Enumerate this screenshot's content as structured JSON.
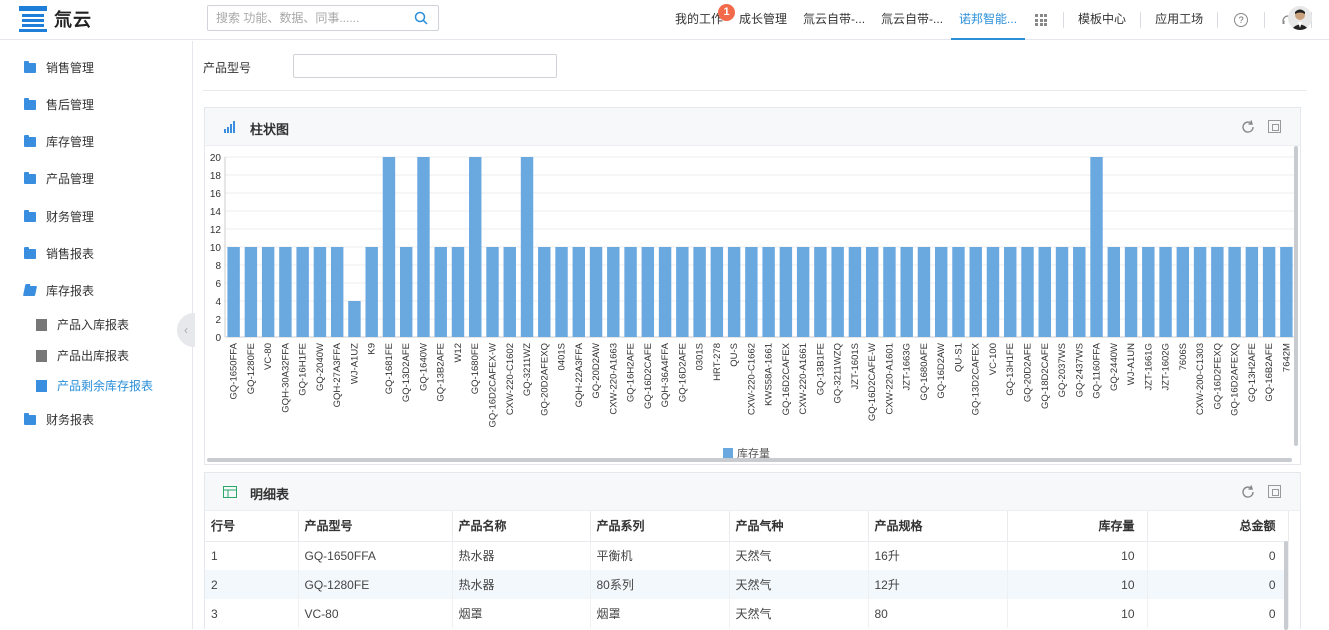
{
  "app": {
    "logo_text": "氚云",
    "search_placeholder": "搜索 功能、数据、同事......",
    "nav": [
      {
        "label": "我的工作",
        "badge": "1"
      },
      {
        "label": "成长管理"
      },
      {
        "label": "氚云自带-..."
      },
      {
        "label": "氚云自带-..."
      },
      {
        "label": "诺邦智能...",
        "active": true
      }
    ],
    "nav_right": [
      "模板中心",
      "应用工场"
    ],
    "accent": "#2a8fd8"
  },
  "sidebar": {
    "items": [
      {
        "label": "销售管理"
      },
      {
        "label": "售后管理"
      },
      {
        "label": "库存管理"
      },
      {
        "label": "产品管理"
      },
      {
        "label": "财务管理"
      },
      {
        "label": "销售报表"
      },
      {
        "label": "库存报表"
      },
      {
        "label": "财务报表"
      }
    ],
    "sub_items": [
      {
        "label": "产品入库报表"
      },
      {
        "label": "产品出库报表"
      },
      {
        "label": "产品剩余库存报表",
        "active": true
      }
    ]
  },
  "filter": {
    "label": "产品型号",
    "value": ""
  },
  "chart_panel": {
    "title": "柱状图"
  },
  "chart_data": {
    "type": "bar",
    "categories": [
      "GQ-1650FFA",
      "GQ-1280FE",
      "VC-80",
      "GQH-30A32FFA",
      "GQ-16H1FE",
      "GQ-2040W",
      "GQH-27A3FFA",
      "WJ-A1UZ",
      "K9",
      "GQ-1681FE",
      "GQ-13D2AFE",
      "GQ-1640W",
      "GQ-13B2AFE",
      "W12",
      "GQ-1680FE",
      "GQ-16D2CAFEX-W",
      "CXW-220-C1602",
      "GQ-3211WZ",
      "GQ-20D2AFEXQ",
      "0401S",
      "GQH-22A3FFA",
      "GQ-20D2AW",
      "CXW-220-A1663",
      "GQ-16H2AFE",
      "GQ-16D2CAFE",
      "GQH-36A4FFA",
      "GQ-16D2AFE",
      "0301S",
      "HRT-278",
      "QU-S",
      "CXW-220-C1662",
      "KWS58A-1661",
      "GQ-16D2CAFEX",
      "CXW-220-A1661",
      "GQ-13B1FE",
      "GQ-3211WZQ",
      "JZT-1601S",
      "GQ-16D2CAFE-W",
      "CXW-220-A1601",
      "JZT-1663G",
      "GQ-1680AFE",
      "GQ-16D2AW",
      "QU-S1",
      "GQ-13D2CAFEX",
      "VC-100",
      "GQ-13H1FE",
      "GQ-20D2AFE",
      "GQ-18D2CAFE",
      "GQ-2037WS",
      "GQ-2437WS",
      "GQ-1160FFA",
      "GQ-2440W",
      "WJ-A1UN",
      "JZT-1661G",
      "JZT-1602G",
      "7606S",
      "CXW-200-C1303",
      "GQ-16D2FEXQ",
      "GQ-16D2AFEXQ",
      "GQ-13H2AFE",
      "GQ-16B2AFE",
      "7642M"
    ],
    "series": [
      {
        "name": "库存量",
        "values": [
          10,
          10,
          10,
          10,
          10,
          10,
          10,
          4,
          10,
          20,
          10,
          20,
          10,
          10,
          20,
          10,
          10,
          20,
          10,
          10,
          10,
          10,
          10,
          10,
          10,
          10,
          10,
          10,
          10,
          10,
          10,
          10,
          10,
          10,
          10,
          10,
          10,
          10,
          10,
          10,
          10,
          10,
          10,
          10,
          10,
          10,
          10,
          10,
          10,
          10,
          20,
          10,
          10,
          10,
          10,
          10,
          10,
          10,
          10,
          10,
          10,
          10
        ]
      }
    ],
    "yticks": [
      0,
      2,
      4,
      6,
      8,
      10,
      12,
      14,
      16,
      18,
      20
    ],
    "ylim": [
      0,
      20
    ],
    "bar_color": "#6aa8e0",
    "grid": true,
    "legend_position": "bottom-center"
  },
  "table_panel": {
    "title": "明细表",
    "columns": [
      "行号",
      "产品型号",
      "产品名称",
      "产品系列",
      "产品气种",
      "产品规格",
      "库存量",
      "总金额"
    ],
    "rows": [
      [
        "1",
        "GQ-1650FFA",
        "热水器",
        "平衡机",
        "天然气",
        "16升",
        "10",
        "0"
      ],
      [
        "2",
        "GQ-1280FE",
        "热水器",
        "80系列",
        "天然气",
        "12升",
        "10",
        "0"
      ],
      [
        "3",
        "VC-80",
        "烟罩",
        "烟罩",
        "天然气",
        "80",
        "10",
        "0"
      ]
    ]
  }
}
